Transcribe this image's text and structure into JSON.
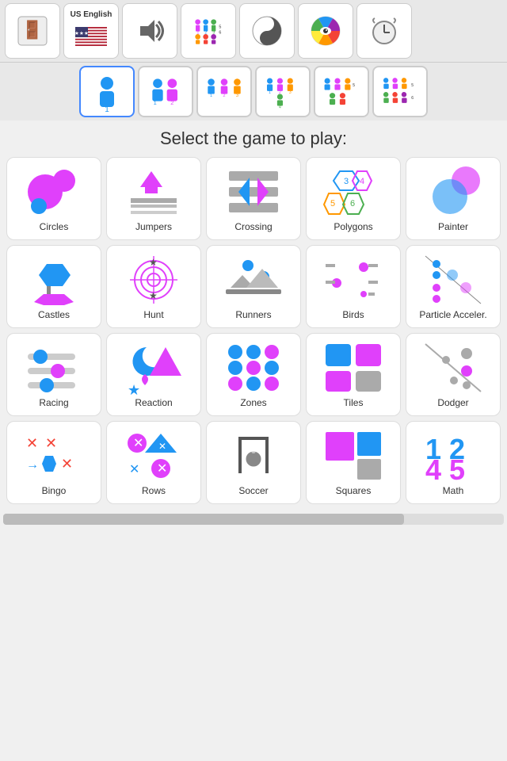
{
  "toolbar": {
    "title": "US English",
    "buttons": [
      {
        "id": "exit",
        "label": "exit"
      },
      {
        "id": "language",
        "label": "US English"
      },
      {
        "id": "sound",
        "label": "sound"
      },
      {
        "id": "players-icon",
        "label": "players"
      },
      {
        "id": "yin-yang",
        "label": "theme"
      },
      {
        "id": "color-wheel",
        "label": "color"
      },
      {
        "id": "alarm",
        "label": "timer"
      }
    ]
  },
  "players": {
    "options": [
      {
        "id": "p1",
        "label": "1",
        "active": true
      },
      {
        "id": "p12",
        "label": "1-2",
        "active": false
      },
      {
        "id": "p123",
        "label": "1-3",
        "active": false
      },
      {
        "id": "p1234",
        "label": "1-4",
        "active": false
      },
      {
        "id": "p12345",
        "label": "1-5",
        "active": false
      },
      {
        "id": "p123456",
        "label": "1-6",
        "active": false
      }
    ]
  },
  "section_title": "Select the game to play:",
  "games": [
    {
      "id": "circles",
      "label": "Circles",
      "type": "circles"
    },
    {
      "id": "jumpers",
      "label": "Jumpers",
      "type": "jumpers"
    },
    {
      "id": "crossing",
      "label": "Crossing",
      "type": "crossing"
    },
    {
      "id": "polygons",
      "label": "Polygons",
      "type": "polygons"
    },
    {
      "id": "painter",
      "label": "Painter",
      "type": "painter"
    },
    {
      "id": "castles",
      "label": "Castles",
      "type": "castles"
    },
    {
      "id": "hunt",
      "label": "Hunt",
      "type": "hunt"
    },
    {
      "id": "runners",
      "label": "Runners",
      "type": "runners"
    },
    {
      "id": "birds",
      "label": "Birds",
      "type": "birds"
    },
    {
      "id": "particle",
      "label": "Particle Acceler.",
      "type": "particle"
    },
    {
      "id": "racing",
      "label": "Racing",
      "type": "racing"
    },
    {
      "id": "reaction",
      "label": "Reaction",
      "type": "reaction"
    },
    {
      "id": "zones",
      "label": "Zones",
      "type": "zones"
    },
    {
      "id": "tiles",
      "label": "Tiles",
      "type": "tiles"
    },
    {
      "id": "dodger",
      "label": "Dodger",
      "type": "dodger"
    },
    {
      "id": "bingo",
      "label": "Bingo",
      "type": "bingo"
    },
    {
      "id": "rows",
      "label": "Rows",
      "type": "rows"
    },
    {
      "id": "soccer",
      "label": "Soccer",
      "type": "soccer"
    },
    {
      "id": "squares",
      "label": "Squares",
      "type": "squares"
    },
    {
      "id": "math",
      "label": "Math",
      "type": "math"
    }
  ]
}
